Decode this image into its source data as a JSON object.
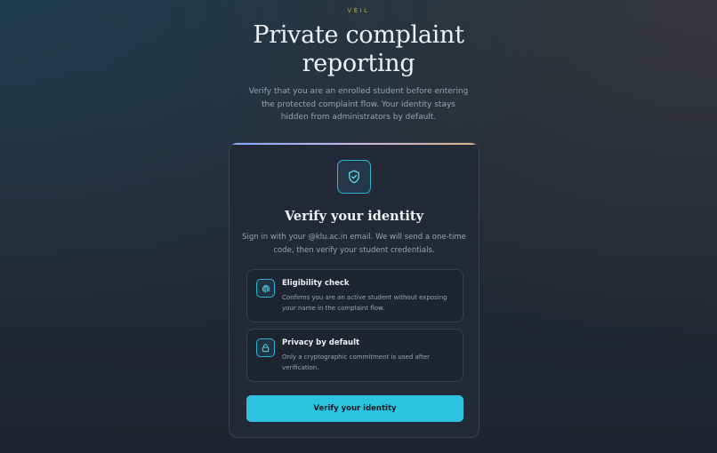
{
  "brand": "VEIL",
  "hero": {
    "title_lines": [
      "Private complaint",
      "reporting"
    ],
    "subtitle_lines": [
      "Verify that you are an enrolled student before entering",
      "the protected complaint flow. Your identity stays",
      "hidden from administrators by default."
    ]
  },
  "card": {
    "icon": "shield-check-icon",
    "title": "Verify your identity",
    "description_lines": [
      "Sign in with your @klu.ac.in email. We will send a one-time",
      "code, then verify your student credentials."
    ],
    "features": [
      {
        "icon": "fingerprint-icon",
        "title": "Eligibility check",
        "description_lines": [
          "Confirms you are an active student without exposing",
          "your name in the complaint flow."
        ]
      },
      {
        "icon": "lock-icon",
        "title": "Privacy by default",
        "description_lines": [
          "Only a cryptographic commitment is used after",
          "verification."
        ]
      }
    ],
    "button_label": "Verify your identity"
  },
  "colors": {
    "accent": "#2bc4e0",
    "brand": "#c9a45b",
    "card_bg": "#232937"
  }
}
